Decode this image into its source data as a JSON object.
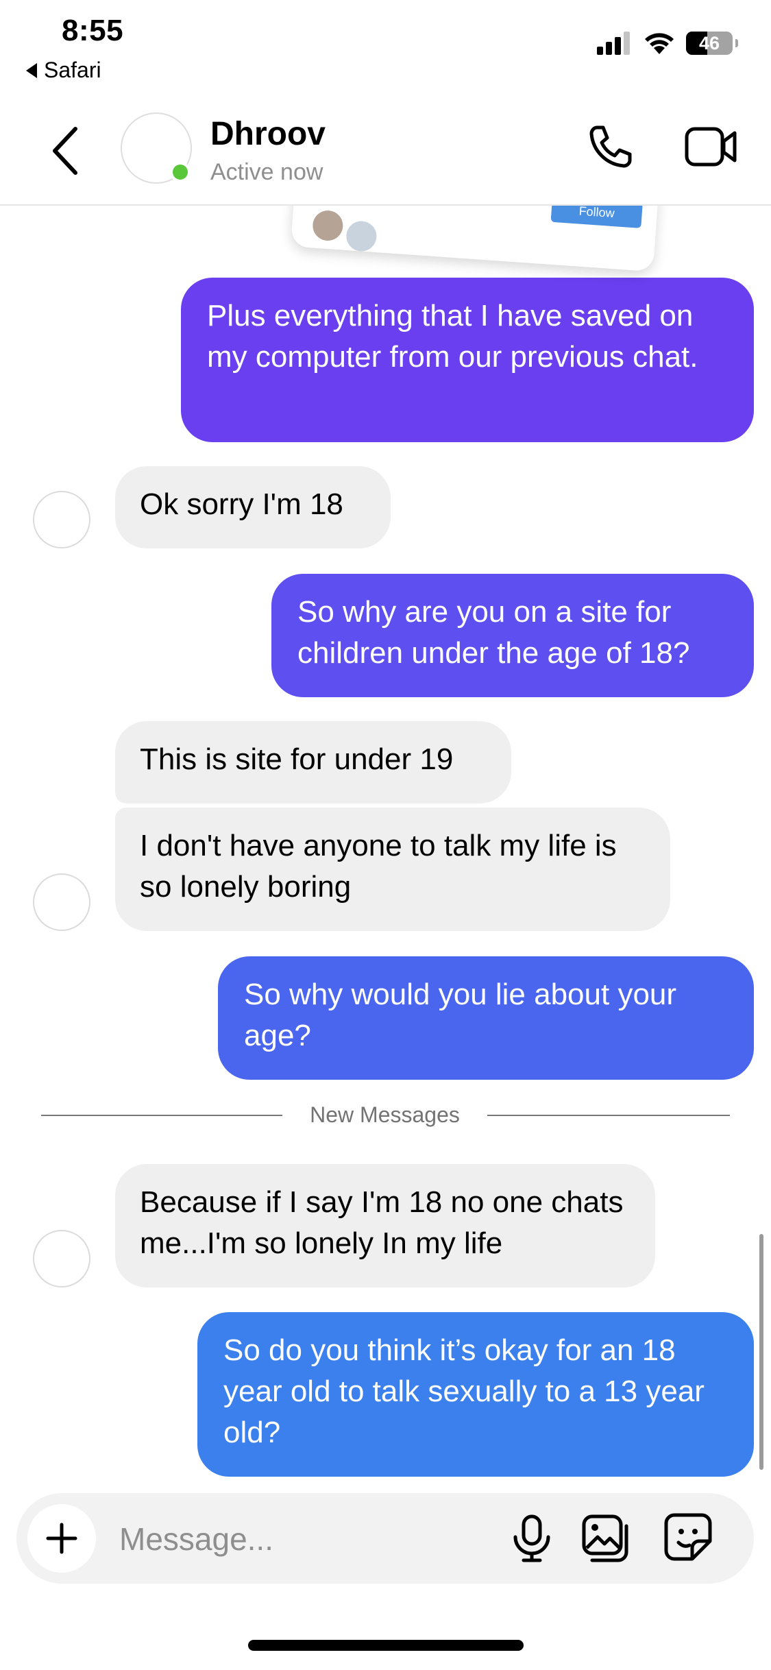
{
  "status_bar": {
    "time": "8:55",
    "back_app": "Safari",
    "battery": "46",
    "battery_level": 0.46
  },
  "header": {
    "name": "Dhroov",
    "status": "Active now",
    "icons": [
      "chevron-left-icon",
      "phone-icon",
      "video-camera-icon"
    ]
  },
  "shared_post": {
    "follow_label": "Follow"
  },
  "messages": [
    {
      "sender": "me",
      "text": "Plus everything that I have saved on my computer from our previous chat.",
      "color": "#6a3ff0"
    },
    {
      "sender": "them",
      "text": "Ok sorry I'm 18"
    },
    {
      "sender": "me",
      "text": "So why are you on a site for children under the age of 18?",
      "color": "#5d4ff0"
    },
    {
      "sender": "them",
      "text": "This is site for under 19"
    },
    {
      "sender": "them",
      "text": "I don't have anyone to talk my life is so lonely boring"
    },
    {
      "sender": "me",
      "text": "So why would you lie about your age?",
      "color": "#4a66ee"
    },
    {
      "sender": "them",
      "text": "Because if I say I'm 18 no one chats me...I'm so lonely In my life"
    },
    {
      "sender": "me",
      "text": "So do you think it’s okay for an 18 year old to talk sexually to a 13 year old?",
      "color": "#3c80ee"
    }
  ],
  "divider": {
    "label": "New Messages"
  },
  "composer": {
    "placeholder": "Message...",
    "icons": [
      "plus-icon",
      "microphone-icon",
      "gallery-icon",
      "sticker-icon"
    ]
  }
}
